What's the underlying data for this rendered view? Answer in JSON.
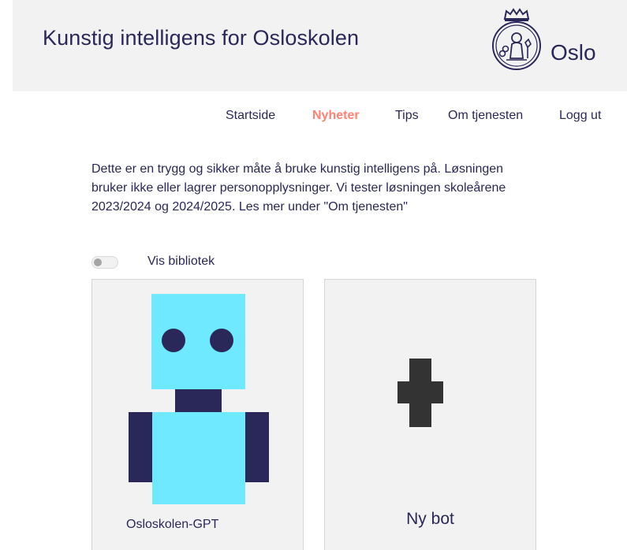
{
  "header": {
    "title": "Kunstig intelligens for Osloskolen",
    "logo_text": "Oslo"
  },
  "nav": {
    "items": [
      {
        "label": "Startside",
        "active": false
      },
      {
        "label": "Nyheter",
        "active": true
      },
      {
        "label": "Tips",
        "active": false
      },
      {
        "label": "Om tjenesten",
        "active": false
      },
      {
        "label": "Logg ut",
        "active": false
      }
    ]
  },
  "intro": {
    "text": "Dette er en trygg og sikker måte å bruke kunstig intelligens på. Løsningen bruker ikke eller lagrer personopplysninger. Vi tester løsningen skoleårene 2023/2024 og 2024/2025. Les mer under \"Om tjenesten\""
  },
  "library_toggle": {
    "label": "Vis bibliotek",
    "checked": false
  },
  "cards": [
    {
      "label": "Osloskolen-GPT",
      "icon": "robot-icon"
    },
    {
      "label": "Ny bot",
      "icon": "plus-icon"
    }
  ],
  "colors": {
    "brand_dark_blue": "#2a2859",
    "active_nav": "#ff8274",
    "robot_light_blue": "#6ee9ff",
    "header_bg": "#f2f2f2",
    "plus_icon": "#333333"
  }
}
